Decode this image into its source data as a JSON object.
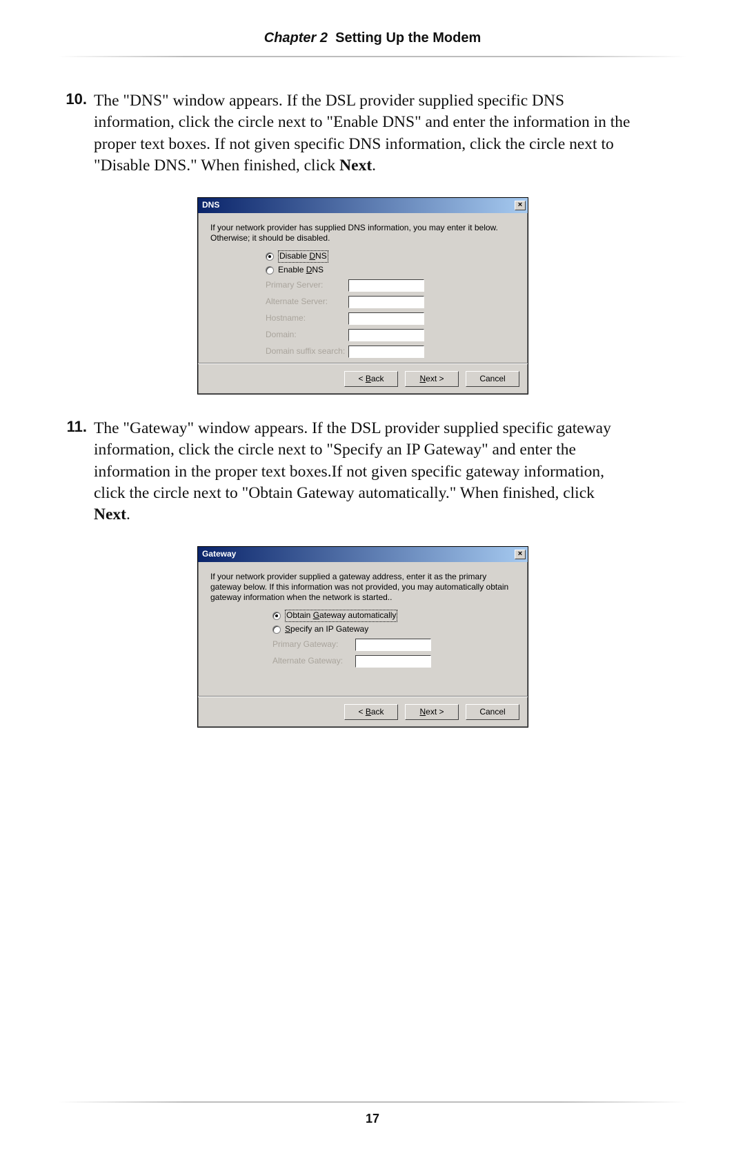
{
  "header": {
    "chapter": "Chapter 2",
    "title": "Setting Up the Modem"
  },
  "page_number": "17",
  "steps": [
    {
      "num": "10.",
      "text_before_bold": "The \"DNS\" window appears. If the DSL provider supplied specific DNS information, click the circle next to \"Enable DNS\" and enter the information in the proper text boxes. If not given specific DNS information, click the circle next to \"Disable DNS.\"  When finished, click ",
      "bold": "Next",
      "text_after_bold": "."
    },
    {
      "num": "11.",
      "text_before_bold": "The \"Gateway\" window appears. If the DSL provider supplied specific gateway information, click the circle next to \"Specify an IP Gateway\" and enter the information in the proper text boxes.If not given specific gateway information, click the circle next to \"Obtain Gateway automatically.\" When finished, click ",
      "bold": "Next",
      "text_after_bold": "."
    }
  ],
  "dlg_dns": {
    "title": "DNS",
    "close": "×",
    "intro": "If your network provider has supplied DNS information, you may enter it below. Otherwise; it should be disabled.",
    "radio_disable_pre": "Disable ",
    "radio_disable_m": "D",
    "radio_disable_post": "NS",
    "radio_enable_pre": "Enable ",
    "radio_enable_m": "D",
    "radio_enable_post": "NS",
    "lbl_primary": "Primary Server:",
    "lbl_alternate": "Alternate Server:",
    "lbl_hostname": "Hostname:",
    "lbl_domain": "Domain:",
    "lbl_suffix": "Domain suffix search:",
    "btn_back_pre": "< ",
    "btn_back_m": "B",
    "btn_back_post": "ack",
    "btn_next_m": "N",
    "btn_next_post": "ext >",
    "btn_cancel": "Cancel"
  },
  "dlg_gw": {
    "title": "Gateway",
    "close": "×",
    "intro": "If your network provider supplied a gateway address, enter it as the primary gateway below. If this information was not provided, you may automatically obtain gateway information when the network is started..",
    "radio_obtain_pre": "Obtain ",
    "radio_obtain_m": "G",
    "radio_obtain_post": "ateway automatically",
    "radio_specify_m": "S",
    "radio_specify_post": "pecify an IP Gateway",
    "lbl_primary": "Primary Gateway:",
    "lbl_alternate": "Alternate Gateway:",
    "btn_back_pre": "< ",
    "btn_back_m": "B",
    "btn_back_post": "ack",
    "btn_next_m": "N",
    "btn_next_post": "ext >",
    "btn_cancel": "Cancel"
  }
}
